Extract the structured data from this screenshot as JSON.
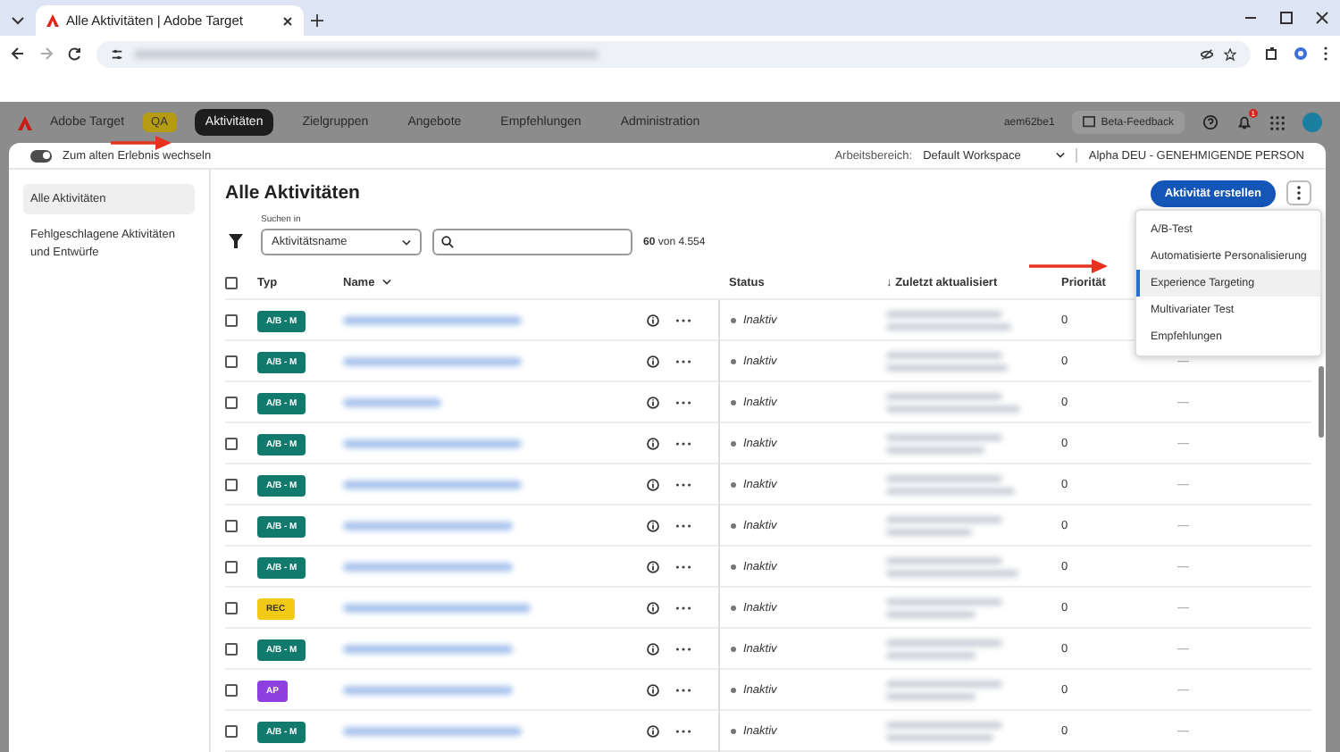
{
  "browser": {
    "tab_title": "Alle Aktivitäten | Adobe Target"
  },
  "app_nav": {
    "product": "Adobe Target",
    "env_badge": "QA",
    "items": [
      {
        "label": "Aktivitäten",
        "selected": true
      },
      {
        "label": "Zielgruppen",
        "selected": false
      },
      {
        "label": "Angebote",
        "selected": false
      },
      {
        "label": "Empfehlungen",
        "selected": false
      },
      {
        "label": "Administration",
        "selected": false
      }
    ],
    "user": "aem62be1",
    "feedback": "Beta-Feedback",
    "notifications": "1"
  },
  "subbar": {
    "toggle_label": "Zum alten Erlebnis wechseln",
    "toggle_on": true,
    "workspace_label": "Arbeitsbereich:",
    "workspace": "Default Workspace",
    "role": "Alpha DEU - GENEHMIGENDE PERSON"
  },
  "sidebar": {
    "items": [
      {
        "label": "Alle Aktivitäten",
        "selected": true
      },
      {
        "label": "Fehlgeschlagene Aktivitäten und Entwürfe",
        "selected": false
      }
    ]
  },
  "main": {
    "title": "Alle Aktivitäten",
    "create_button": "Aktivität erstellen",
    "search_in_label": "Suchen in",
    "search_in": "Aktivitätsname",
    "count": "60 von 4.554"
  },
  "menu": {
    "items": [
      {
        "label": "A/B-Test",
        "selected": false
      },
      {
        "label": "Automatisierte Personalisierung",
        "selected": false
      },
      {
        "label": "Experience Targeting",
        "selected": true
      },
      {
        "label": "Multivariater Test",
        "selected": false
      },
      {
        "label": "Empfehlungen",
        "selected": false
      }
    ]
  },
  "table": {
    "select_all_checked": false,
    "sort_indicator": "↓",
    "columns": [
      "Typ",
      "Name",
      "Status",
      "Zuletzt aktualisiert",
      "Priorität"
    ],
    "rows": [
      {
        "type": "A/B - M",
        "kind": "ab",
        "checked": false,
        "status": "Inaktiv",
        "priority": "0"
      },
      {
        "type": "A/B - M",
        "kind": "ab",
        "checked": false,
        "status": "Inaktiv",
        "priority": "0",
        "column_6": "—"
      },
      {
        "type": "A/B - M",
        "kind": "ab",
        "checked": false,
        "status": "Inaktiv",
        "priority": "0",
        "column_6": "—"
      },
      {
        "type": "A/B - M",
        "kind": "ab",
        "checked": false,
        "status": "Inaktiv",
        "priority": "0",
        "column_6": "—"
      },
      {
        "type": "A/B - M",
        "kind": "ab",
        "checked": false,
        "status": "Inaktiv",
        "priority": "0",
        "column_6": "—"
      },
      {
        "type": "A/B - M",
        "kind": "ab",
        "checked": false,
        "status": "Inaktiv",
        "priority": "0",
        "column_6": "—"
      },
      {
        "type": "A/B - M",
        "kind": "ab",
        "checked": false,
        "status": "Inaktiv",
        "priority": "0",
        "column_6": "—"
      },
      {
        "type": "REC",
        "kind": "rec",
        "checked": false,
        "status": "Inaktiv",
        "priority": "0",
        "column_6": "—"
      },
      {
        "type": "A/B - M",
        "kind": "ab",
        "checked": false,
        "status": "Inaktiv",
        "priority": "0",
        "column_6": "—"
      },
      {
        "type": "AP",
        "kind": "ap",
        "checked": false,
        "status": "Inaktiv",
        "priority": "0",
        "column_6": "—"
      },
      {
        "type": "A/B - M",
        "kind": "ab",
        "checked": false,
        "status": "Inaktiv",
        "priority": "0",
        "column_6": "—"
      }
    ]
  }
}
